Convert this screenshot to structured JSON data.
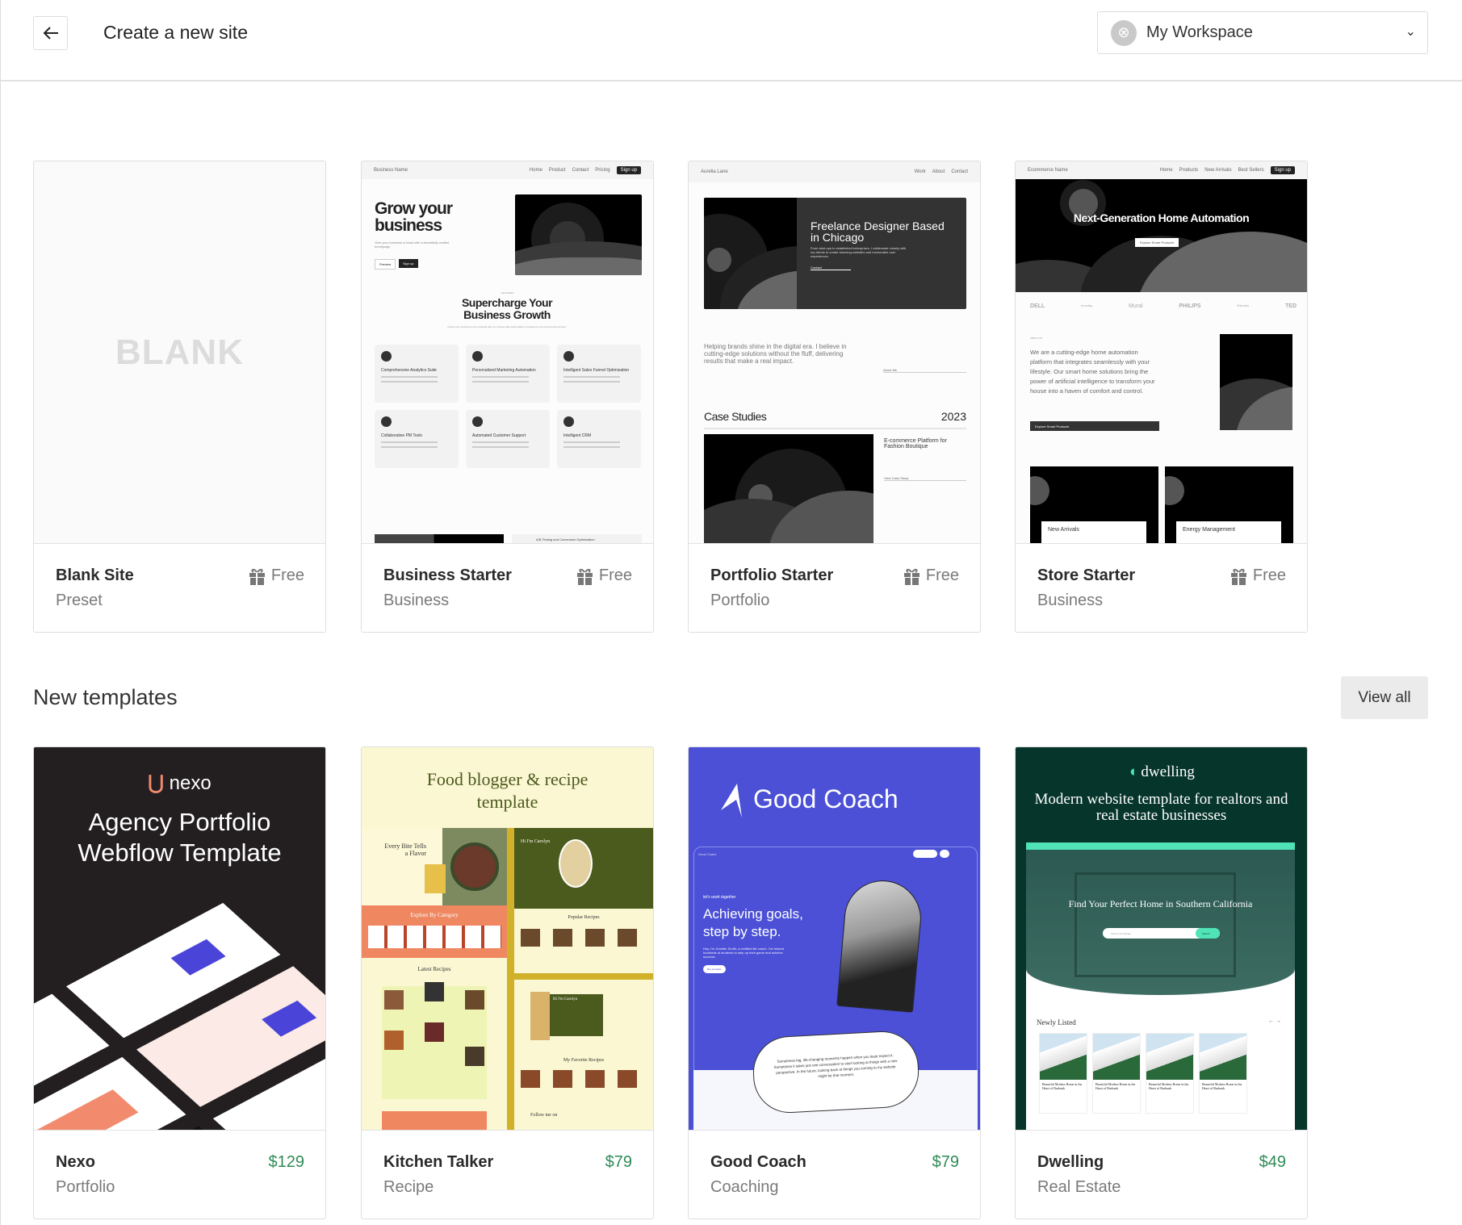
{
  "header": {
    "title": "Create a new site",
    "back_icon": "arrow-left-icon",
    "workspace": {
      "label": "My Workspace",
      "icon": "workspace-avatar-icon",
      "chevron": "chevron-down-icon"
    }
  },
  "starters": [
    {
      "name": "Blank Site",
      "category": "Preset",
      "price": "Free",
      "price_icon": "gift-icon",
      "preview": {
        "label": "BLANK"
      }
    },
    {
      "name": "Business Starter",
      "category": "Business",
      "price": "Free",
      "price_icon": "gift-icon",
      "preview": {
        "brand": "Business Name",
        "nav": [
          "Home",
          "Product",
          "Contact",
          "Pricing"
        ],
        "nav_button": "Sign up",
        "headline": "Grow your business",
        "subtext": "Give your business a boost with a beautifully crafted homepage.",
        "btn1": "Preview",
        "btn2": "Sign up",
        "eyebrow": "FEATURES",
        "section_title": "Supercharge Your Business Growth",
        "section_sub": "Unlock your business's true potential with our cutting-edge SaaS platform designed to fuel growth and success.",
        "features": [
          "Comprehensive Analytics Suite",
          "Personalized Marketing Automation",
          "Intelligent Sales Funnel Optimization",
          "Collaborative PM Tools",
          "Automated Customer Support",
          "Intelligent CRM"
        ],
        "bottom": "A/B Testing and Conversion Optimization"
      }
    },
    {
      "name": "Portfolio Starter",
      "category": "Portfolio",
      "price": "Free",
      "price_icon": "gift-icon",
      "preview": {
        "brand": "Aurelia Lane",
        "nav": [
          "Work",
          "About",
          "Contact"
        ],
        "headline": "Freelance Designer Based in Chicago",
        "hero_text": "From start-ups to established enterprises, I collaborate closely with my clients to create stunning websites and memorable user experiences.",
        "contact": "Contact",
        "intro": "Helping brands shine in the digital era. I believe in cutting-edge solutions without the fluff, delivering results that make a real impact.",
        "about": "About Me",
        "case_title": "Case Studies",
        "year": "2023",
        "case_name": "E-commerce Platform for Fashion Boutique",
        "case_link": "View Case Study"
      }
    },
    {
      "name": "Store Starter",
      "category": "Business",
      "price": "Free",
      "price_icon": "gift-icon",
      "preview": {
        "brand": "Ecommerce Name",
        "nav": [
          "Home",
          "Products",
          "New Arrivals",
          "Best Sellers"
        ],
        "nav_button": "Sign up",
        "headline": "Next-Generation Home Automation",
        "hero_button": "Explore Smart Products",
        "logos": [
          "DELL",
          "monday",
          "Mural",
          "PHILIPS",
          "Rakuten",
          "TED"
        ],
        "eyebrow": "ABOUT US",
        "about": "We are a cutting-edge home automation platform that integrates seamlessly with your lifestyle. Our smart home solutions bring the power of artificial intelligence to transform your house into a haven of comfort and control.",
        "about_button": "Explore Smart Products",
        "cards": [
          "New Arrivals",
          "Energy Management"
        ]
      }
    }
  ],
  "new_templates": {
    "title": "New templates",
    "view_all": "View all",
    "items": [
      {
        "name": "Nexo",
        "category": "Portfolio",
        "price": "$129",
        "preview": {
          "logo": "nexo",
          "headline": "Agency Portfolio Webflow Template",
          "bg": "#231f20",
          "accent": "#f28b6e"
        }
      },
      {
        "name": "Kitchen Talker",
        "category": "Recipe",
        "price": "$79",
        "preview": {
          "headline": "Food blogger & recipe template",
          "hero": "Every Bite Tells a Flavor",
          "explore": "Explore By Category",
          "popular": "Popular Recipes",
          "latest": "Latest Recipes",
          "hi": "Hi I'm Carolyn",
          "favorite": "My Favorite Recipes",
          "follow": "Follow me on",
          "bg": "#fbf7d3",
          "olive": "#4b5a1d",
          "salmon": "#ef8761",
          "gold": "#d2b12a"
        }
      },
      {
        "name": "Good Coach",
        "category": "Coaching",
        "price": "$79",
        "preview": {
          "logo": "Good Coach",
          "brand": "Good Coach",
          "eyebrow": "let's work together",
          "headline": "Achieving goals, step by step.",
          "text": "Hey, I'm Jennifer Smith, a certified life coach. I've helped hundreds of students to step up their game and achieve success.",
          "button": "Buy template",
          "quote": "Sometimes big, life-changing moments happen when you least expect it. Sometimes it takes just one conversation to start looking at things with a new perspective. In the future, looking back at things you coming to my website might be that moment.",
          "bg": "#4b50d6"
        }
      },
      {
        "name": "Dwelling",
        "category": "Real Estate",
        "price": "$49",
        "preview": {
          "logo": "dwelling",
          "headline": "Modern website template for realtors and real estate businesses",
          "hero": "Find Your Perfect Home in Southern California",
          "search": "Search our listings",
          "search_btn": "Search",
          "newly": "Newly Listed",
          "listing": "Beautiful Modern Home in the Heart of Burbank",
          "bg": "#06352b",
          "accent": "#4fe3b5"
        }
      }
    ]
  }
}
